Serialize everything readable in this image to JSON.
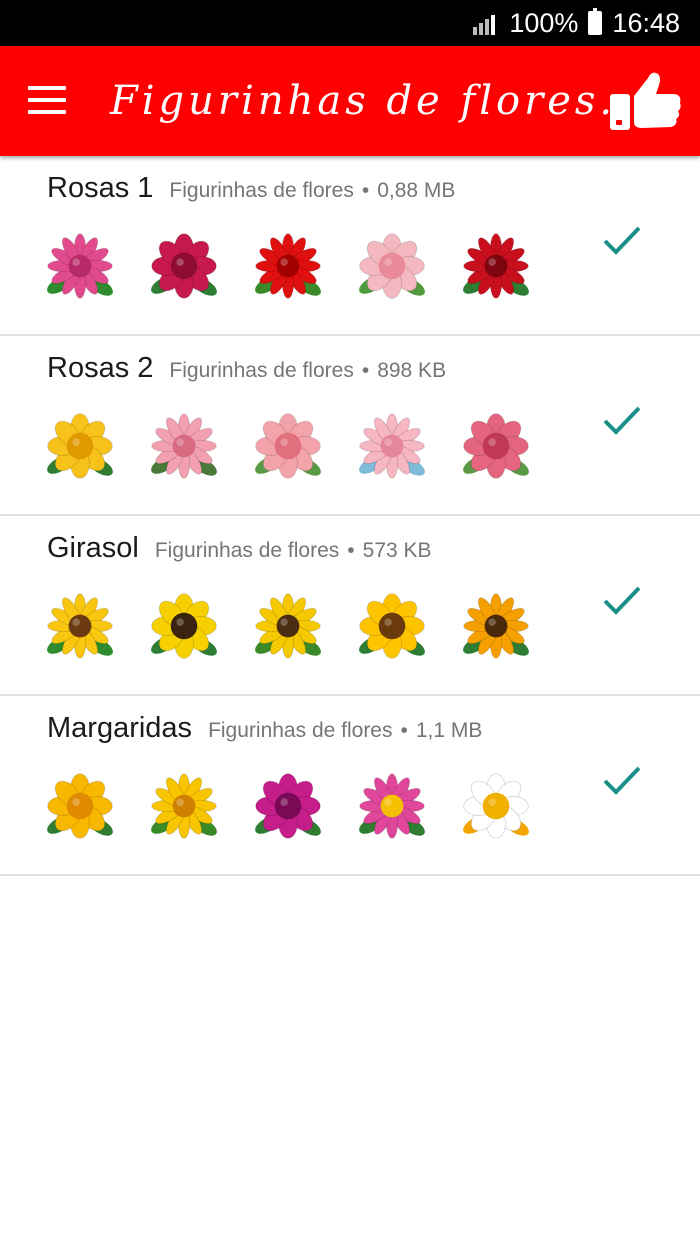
{
  "status_bar": {
    "battery": "100%",
    "time": "16:48"
  },
  "app_bar": {
    "title": "Figurinhas de flores...",
    "menu_icon": "hamburger-menu-icon",
    "like_icon": "thumbs-up-icon"
  },
  "colors": {
    "app_bar": "#ff0000",
    "check": "#1d8f8a",
    "divider": "#e0e0e0"
  },
  "packs": [
    {
      "name": "Rosas 1",
      "publisher": "Figurinhas de flores",
      "separator": "•",
      "size": "0,88 MB",
      "added": true,
      "stickers": [
        {
          "icon": "pink-rose-icon",
          "petal": "#e24a8e",
          "center": "#b72a68",
          "leaf": "#2e8b2e"
        },
        {
          "icon": "crimson-rose-icon",
          "petal": "#c8194e",
          "center": "#8f0d33",
          "leaf": "#2e7d32"
        },
        {
          "icon": "red-rose-bouquet-icon",
          "petal": "#e01010",
          "center": "#a30000",
          "leaf": "#3a8a2a"
        },
        {
          "icon": "pale-roses-icon",
          "petal": "#f4b9c0",
          "center": "#e88a99",
          "leaf": "#4f9a3f"
        },
        {
          "icon": "red-rose-icon",
          "petal": "#c90f1e",
          "center": "#7d0510",
          "leaf": "#2e7d32"
        }
      ]
    },
    {
      "name": "Rosas 2",
      "publisher": "Figurinhas de flores",
      "separator": "•",
      "size": "898 KB",
      "added": true,
      "stickers": [
        {
          "icon": "yellow-rose-icon",
          "petal": "#f7c21a",
          "center": "#e09a00",
          "leaf": "#2e7d32"
        },
        {
          "icon": "pink-roses-icon",
          "petal": "#f2a0b0",
          "center": "#d86a82",
          "leaf": "#4a7a3a"
        },
        {
          "icon": "rose-bouquet-icon",
          "petal": "#f3a3aa",
          "center": "#e0707c",
          "leaf": "#5a9a45"
        },
        {
          "icon": "rose-garland-icon",
          "petal": "#f6b6c2",
          "center": "#e5879b",
          "leaf": "#7fbad8"
        },
        {
          "icon": "small-roses-icon",
          "petal": "#e5657e",
          "center": "#c03a55",
          "leaf": "#5a9a45"
        }
      ]
    },
    {
      "name": "Girasol",
      "publisher": "Figurinhas de flores",
      "separator": "•",
      "size": "573 KB",
      "added": true,
      "stickers": [
        {
          "icon": "sunflower-stems-icon",
          "petal": "#f9c710",
          "center": "#6b3a10",
          "leaf": "#2e8b2e"
        },
        {
          "icon": "sunflower-icon",
          "petal": "#f6d000",
          "center": "#3a2410",
          "leaf": "#2e7d32"
        },
        {
          "icon": "sunflower-row-icon",
          "petal": "#f6c800",
          "center": "#4a2c10",
          "leaf": "#3a8a2a"
        },
        {
          "icon": "bright-sunflower-icon",
          "petal": "#ffc400",
          "center": "#6a3a0a",
          "leaf": "#2e7d32"
        },
        {
          "icon": "orange-sunflower-icon",
          "petal": "#f5a000",
          "center": "#4a2a0a",
          "leaf": "#2e7d32"
        }
      ]
    },
    {
      "name": "Margaridas",
      "publisher": "Figurinhas de flores",
      "separator": "•",
      "size": "1,1 MB",
      "added": true,
      "stickers": [
        {
          "icon": "yellow-daisy-icon",
          "petal": "#f9b800",
          "center": "#e08a00",
          "leaf": "#2e7d32"
        },
        {
          "icon": "gerbera-icon",
          "petal": "#f9c400",
          "center": "#d08000",
          "leaf": "#3a8a2a"
        },
        {
          "icon": "magenta-flower-icon",
          "petal": "#c51d8a",
          "center": "#7a0a55",
          "leaf": "#2e7d32"
        },
        {
          "icon": "pink-aster-icon",
          "petal": "#e0479a",
          "center": "#f5c000",
          "leaf": "#2e7d32"
        },
        {
          "icon": "daisy-cluster-icon",
          "petal": "#ffffff",
          "center": "#f0b000",
          "leaf": "#f3a500"
        }
      ]
    }
  ]
}
